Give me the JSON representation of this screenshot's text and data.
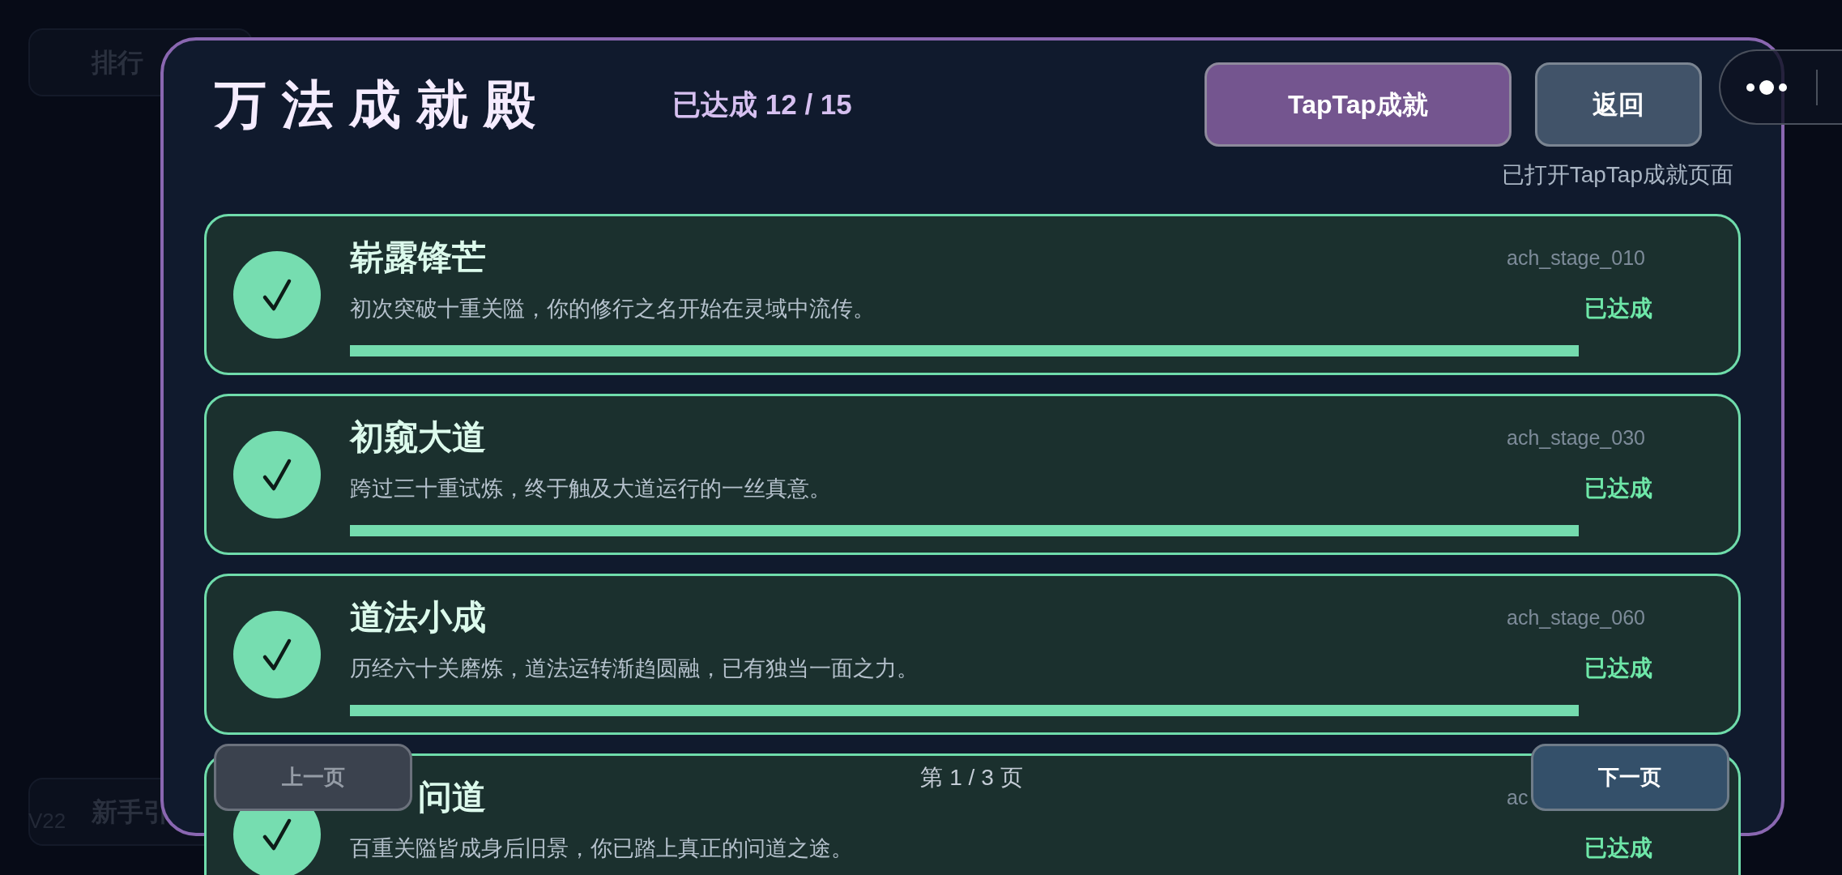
{
  "background": {
    "buttons": [
      {
        "label": "排行"
      },
      {
        "label": "新手引"
      }
    ],
    "version": "V22"
  },
  "dialog": {
    "title": "万法成就殿",
    "progress": "已达成 12 / 15",
    "actions": [
      {
        "label": "TapTap成就",
        "kind": "primary"
      },
      {
        "label": "返回",
        "kind": "secondary"
      }
    ],
    "notice": "已打开TapTap成就页面",
    "achievements": [
      {
        "title": "崭露锋芒",
        "description": "初次突破十重关隘，你的修行之名开始在灵域中流传。",
        "id": "ach_stage_010",
        "status": "已达成",
        "achieved": true,
        "level": 1
      },
      {
        "title": "初窥大道",
        "description": "跨过三十重试炼，终于触及大道运行的一丝真意。",
        "id": "ach_stage_030",
        "status": "已达成",
        "achieved": true,
        "level": 1
      },
      {
        "title": "道法小成",
        "description": "历经六十关磨炼，道法运转渐趋圆融，已有独当一面之力。",
        "id": "ach_stage_060",
        "status": "已达成",
        "achieved": true,
        "level": 1
      },
      {
        "title": "问道",
        "title_partly_covered": true,
        "description": "百重关隘皆成身后旧景，你已踏上真正的问道之途。",
        "id": "ac",
        "status": "已达成",
        "achieved": true
      }
    ],
    "pagination": {
      "previous": {
        "label": "上一页",
        "disabled": true
      },
      "page": "第 1 / 3 页",
      "next": {
        "label": "下一页",
        "disabled": false
      }
    }
  }
}
